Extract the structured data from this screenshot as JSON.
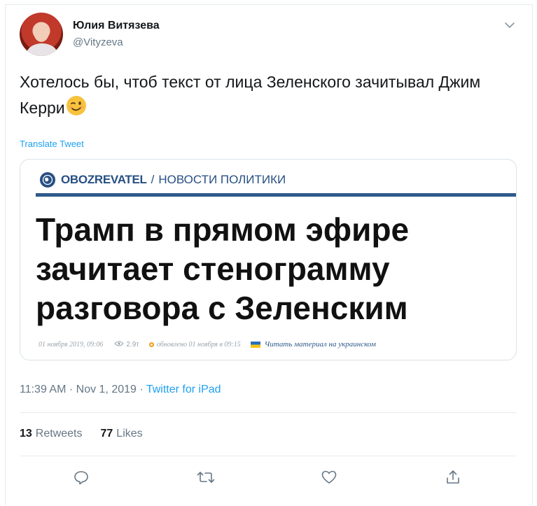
{
  "author": {
    "name": "Юлия Витязева",
    "handle": "@Vityzeva"
  },
  "tweet": {
    "text": "Хотелось бы, чтоб текст от лица Зеленского зачитывал Джим Керри",
    "emoji": "winking-face",
    "translate_label": "Translate Tweet"
  },
  "card": {
    "brand": "OBOZREVATEL",
    "separator": "/",
    "section": "НОВОСТИ ПОЛИТИКИ",
    "headline": "Трамп в прямом эфире зачитает стенограмму разговора с Зеленским",
    "meta": {
      "date": "01 ноября 2019, 09:06",
      "views": "2.9т",
      "updated": "обновлено 01 ноября в 09:15",
      "read_ua": "Читать материал на украинском"
    }
  },
  "timestamp": {
    "time": "11:39 AM · Nov 1, 2019 · ",
    "source": "Twitter for iPad"
  },
  "stats": {
    "retweets_count": "13",
    "retweets_label": "Retweets",
    "likes_count": "77",
    "likes_label": "Likes"
  },
  "actions": {
    "reply": "reply-icon",
    "retweet": "retweet-icon",
    "like": "heart-icon",
    "share": "share-icon"
  },
  "colors": {
    "accent": "#1da1f2",
    "secondary_text": "#657786",
    "brand_blue": "#274f83"
  }
}
